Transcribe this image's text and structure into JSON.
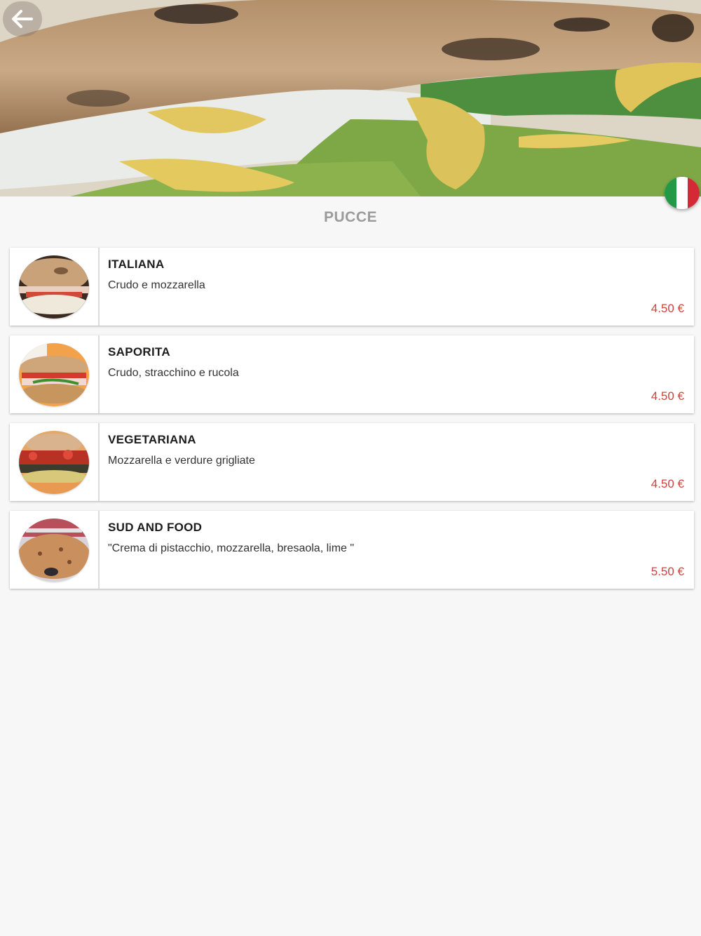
{
  "header": {
    "back_icon": "arrow-left-icon",
    "language_flag": "italy-flag-icon"
  },
  "colors": {
    "background": "#f7f7f7",
    "title": "#9b9b9b",
    "price": "#d0433a",
    "card": "#ffffff"
  },
  "section": {
    "title": "PUCCE"
  },
  "items": [
    {
      "name": "ITALIANA",
      "description": "Crudo e mozzarella",
      "price": "4.50 €"
    },
    {
      "name": "SAPORITA",
      "description": "Crudo, stracchino e rucola",
      "price": "4.50 €"
    },
    {
      "name": "VEGETARIANA",
      "description": "Mozzarella e verdure grigliate",
      "price": "4.50 €"
    },
    {
      "name": "SUD AND FOOD",
      "description": "\"Crema di pistacchio, mozzarella, bresaola, lime \"",
      "price": "5.50 €"
    }
  ]
}
